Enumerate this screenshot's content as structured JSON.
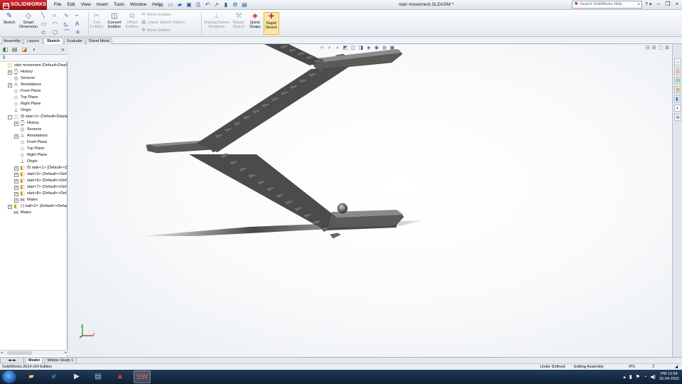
{
  "app": {
    "brand": "SOLIDWORKS",
    "doc_title": "stair movement.SLDASM *"
  },
  "menu": [
    "File",
    "Edit",
    "View",
    "Insert",
    "Tools",
    "Window",
    "Help"
  ],
  "search": {
    "placeholder": "Search SolidWorks Help"
  },
  "commands": {
    "sketch": "Sketch",
    "smart_dimension": "Smart Dimension",
    "trim": "Trim Entities",
    "convert": "Convert Entities",
    "offset": "Offset Entities",
    "mirror": "Mirror Entities",
    "linear_pattern": "Linear Sketch Pattern",
    "move": "Move Entities",
    "display_delete": "Display/Delete Relations",
    "repair": "Repair Sketch",
    "quick_snaps": "Quick Snaps",
    "rapid_sketch": "Rapid Sketch"
  },
  "tabs": [
    "Assembly",
    "Layout",
    "Sketch",
    "Evaluate",
    "Sheet Metal"
  ],
  "active_tab": "Sketch",
  "tree": [
    {
      "label": "stair movement  (Default<Displ",
      "level": 0,
      "icon": "assembly-icon",
      "exp": ""
    },
    {
      "label": "History",
      "level": 1,
      "icon": "history-icon",
      "exp": "+"
    },
    {
      "label": "Sensors",
      "level": 1,
      "icon": "sensors-icon",
      "exp": ""
    },
    {
      "label": "Annotations",
      "level": 1,
      "icon": "annotations-icon",
      "exp": "+"
    },
    {
      "label": "Front Plane",
      "level": 1,
      "icon": "plane-icon",
      "exp": ""
    },
    {
      "label": "Top Plane",
      "level": 1,
      "icon": "plane-icon",
      "exp": ""
    },
    {
      "label": "Right Plane",
      "level": 1,
      "icon": "plane-icon",
      "exp": ""
    },
    {
      "label": "Origin",
      "level": 1,
      "icon": "origin-icon",
      "exp": ""
    },
    {
      "label": "(f) stair<1> (Default<Displa",
      "level": 1,
      "icon": "subassembly-icon",
      "exp": "-"
    },
    {
      "label": "History",
      "level": 2,
      "icon": "history-icon",
      "exp": "+"
    },
    {
      "label": "Sensors",
      "level": 2,
      "icon": "sensors-icon",
      "exp": ""
    },
    {
      "label": "Annotations",
      "level": 2,
      "icon": "annotations-icon",
      "exp": "+"
    },
    {
      "label": "Front Plane",
      "level": 2,
      "icon": "plane-icon",
      "exp": ""
    },
    {
      "label": "Top Plane",
      "level": 2,
      "icon": "plane-icon",
      "exp": ""
    },
    {
      "label": "Right Plane",
      "level": 2,
      "icon": "plane-icon",
      "exp": ""
    },
    {
      "label": "Origin",
      "level": 2,
      "icon": "origin-icon",
      "exp": ""
    },
    {
      "label": "(f) stair<1> (Default<<D",
      "level": 2,
      "icon": "part-icon",
      "exp": "+"
    },
    {
      "label": "stair<2> (Default<<Def",
      "level": 2,
      "icon": "part-icon",
      "exp": "+"
    },
    {
      "label": "stair<6> (Default<<Def",
      "level": 2,
      "icon": "part-icon",
      "exp": "+"
    },
    {
      "label": "stair<7> (Default<<Def",
      "level": 2,
      "icon": "part-icon",
      "exp": "+"
    },
    {
      "label": "stair<8> (Default<<Def",
      "level": 2,
      "icon": "part-icon",
      "exp": "+"
    },
    {
      "label": "Mates",
      "level": 2,
      "icon": "mates-icon",
      "exp": "+"
    },
    {
      "label": "(-) ball<2> (Default<<Defaul",
      "level": 1,
      "icon": "part-icon",
      "exp": "+"
    },
    {
      "label": "Mates",
      "level": 1,
      "icon": "mates-icon",
      "exp": ""
    }
  ],
  "model_tabs": [
    "Model",
    "Motion Study 1"
  ],
  "status": {
    "edition": "SolidWorks 2014 x64 Edition",
    "state": "Under Defined",
    "mode": "Editing Assembly",
    "units": "IPS"
  },
  "taskbar": {
    "time": "PM 12:54",
    "date": "15-04-2015"
  }
}
